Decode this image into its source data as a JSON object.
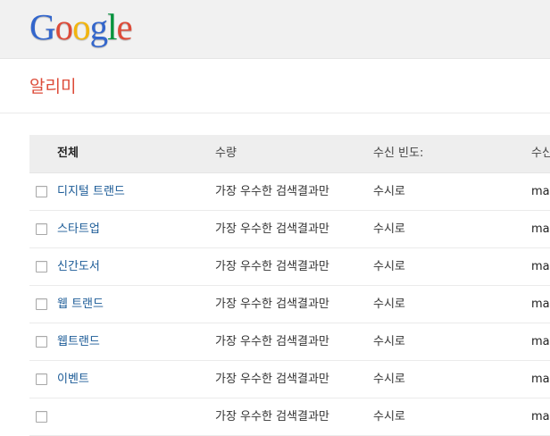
{
  "header": {
    "logo_letters": [
      {
        "ch": "G",
        "color": "#3366cc"
      },
      {
        "ch": "o",
        "color": "#dd4b39"
      },
      {
        "ch": "o",
        "color": "#f2b50f"
      },
      {
        "ch": "g",
        "color": "#3366cc"
      },
      {
        "ch": "l",
        "color": "#00933b"
      },
      {
        "ch": "e",
        "color": "#dd4b39"
      }
    ]
  },
  "page": {
    "title": "알리미"
  },
  "table": {
    "columns": {
      "all": "전체",
      "quantity": "수량",
      "frequency": "수신 빈도:",
      "recipient": "수신"
    },
    "rows": [
      {
        "name": "디지털 트랜드",
        "quantity": "가장 우수한 검색결과만",
        "frequency": "수시로",
        "recipient": "mak"
      },
      {
        "name": "스타트업",
        "quantity": "가장 우수한 검색결과만",
        "frequency": "수시로",
        "recipient": "mak"
      },
      {
        "name": "신간도서",
        "quantity": "가장 우수한 검색결과만",
        "frequency": "수시로",
        "recipient": "mak"
      },
      {
        "name": "웹 트랜드",
        "quantity": "가장 우수한 검색결과만",
        "frequency": "수시로",
        "recipient": "mak"
      },
      {
        "name": "웹트랜드",
        "quantity": "가장 우수한 검색결과만",
        "frequency": "수시로",
        "recipient": "mak"
      },
      {
        "name": "이벤트",
        "quantity": "가장 우수한 검색결과만",
        "frequency": "수시로",
        "recipient": "mak"
      },
      {
        "name": "",
        "quantity": "가장 우수한 검색결과만",
        "frequency": "수시로",
        "recipient": "mak"
      }
    ]
  }
}
